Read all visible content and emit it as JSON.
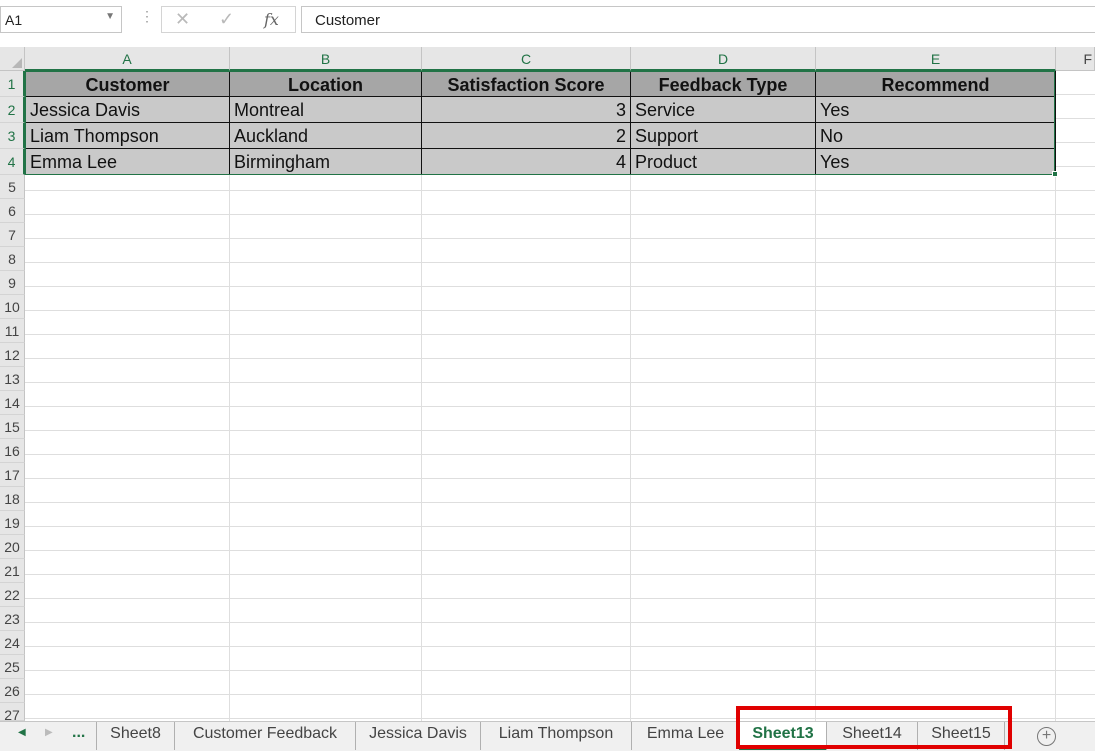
{
  "formula_bar": {
    "name_box": "A1",
    "fx_label": "fx",
    "cancel_glyph": "✕",
    "enter_glyph": "✓",
    "content": "Customer"
  },
  "columns": [
    "A",
    "B",
    "C",
    "D",
    "E"
  ],
  "partial_column": "F",
  "rows": [
    "1",
    "2",
    "3",
    "4",
    "5",
    "6",
    "7",
    "8",
    "9",
    "10",
    "11",
    "12",
    "13",
    "14",
    "15",
    "16",
    "17",
    "18",
    "19",
    "20",
    "21",
    "22",
    "23",
    "24",
    "25",
    "26",
    "27"
  ],
  "table": {
    "headers": [
      "Customer",
      "Location",
      "Satisfaction Score",
      "Feedback Type",
      "Recommend"
    ],
    "rows": [
      [
        "Jessica Davis",
        "Montreal",
        "3",
        "Service",
        "Yes"
      ],
      [
        "Liam Thompson",
        "Auckland",
        "2",
        "Support",
        "No"
      ],
      [
        "Emma Lee",
        "Birmingham",
        "4",
        "Product",
        "Yes"
      ]
    ]
  },
  "sheet_tabs": {
    "overflow": "...",
    "tabs": [
      "Sheet8",
      "Customer Feedback",
      "Jessica Davis",
      "Liam Thompson",
      "Emma Lee",
      "Sheet13",
      "Sheet14",
      "Sheet15"
    ],
    "active": "Sheet13",
    "add_glyph": "+"
  },
  "colors": {
    "accent": "#217346",
    "header_fill": "#a6a6a6",
    "data_fill": "#c9c9c9",
    "highlight": "#e00000"
  }
}
